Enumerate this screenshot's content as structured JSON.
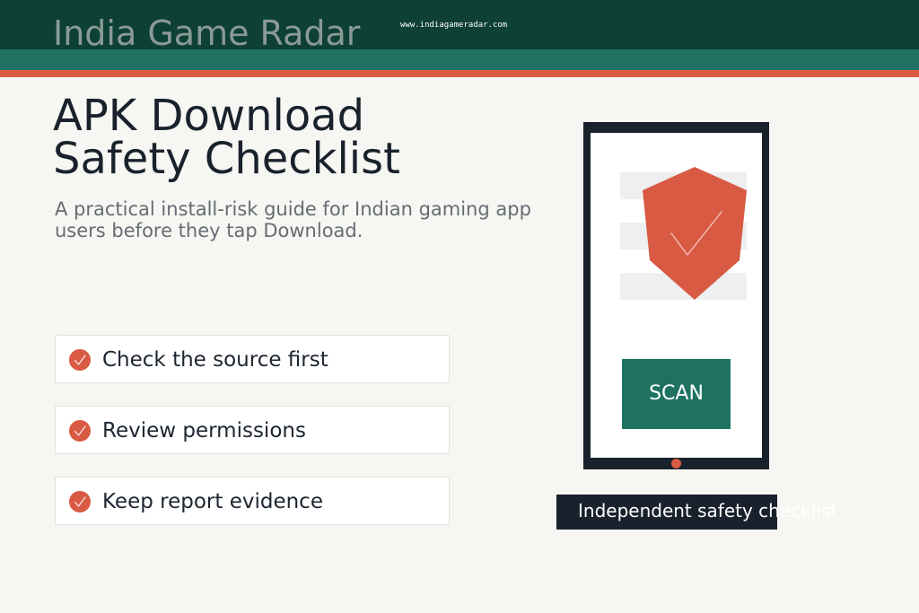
{
  "header": {
    "brand": "India Game Radar",
    "url": "www.indiagameradar.com"
  },
  "hero": {
    "title_line_1": "APK Download",
    "title_line_2": "Safety Checklist",
    "subtitle": "A practical install-risk guide for Indian gaming app users before they tap Download."
  },
  "checklist": {
    "items": [
      {
        "label": "Check the source first",
        "icon": "check-circle-icon"
      },
      {
        "label": "Review permissions",
        "icon": "check-circle-icon"
      },
      {
        "label": "Keep report evidence",
        "icon": "check-circle-icon"
      }
    ]
  },
  "illustration": {
    "scan_label": "SCAN",
    "shield_icon": "shield-check-icon",
    "caption": "Independent safety checklist"
  },
  "colors": {
    "header_dark": "#0e4035",
    "header_teal": "#1f7262",
    "accent_red": "#d85a43",
    "ink": "#19222c",
    "background": "#f6f6f2"
  }
}
